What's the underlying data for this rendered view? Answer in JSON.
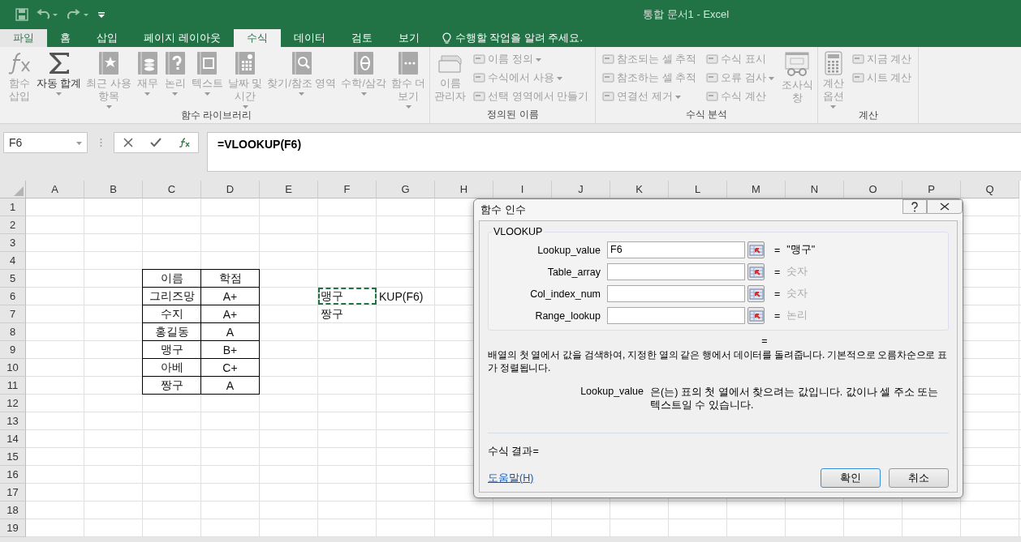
{
  "window": {
    "title": "통합 문서1 - Excel"
  },
  "tabs": [
    {
      "label": "파일",
      "kind": "file",
      "selected": false
    },
    {
      "label": "홈",
      "kind": "tab",
      "selected": false
    },
    {
      "label": "삽입",
      "kind": "tab",
      "selected": false
    },
    {
      "label": "페이지 레이아웃",
      "kind": "tab",
      "selected": false
    },
    {
      "label": "수식",
      "kind": "tab",
      "selected": true
    },
    {
      "label": "데이터",
      "kind": "tab",
      "selected": false
    },
    {
      "label": "검토",
      "kind": "tab",
      "selected": false
    },
    {
      "label": "보기",
      "kind": "tab",
      "selected": false
    }
  ],
  "tell_me": {
    "label": "수행할 작업을 알려 주세요."
  },
  "ribbon": {
    "groups": [
      {
        "label": "함수 라이브러리",
        "items": [
          {
            "kind": "large",
            "label": "함수\n삽입",
            "disabled": true,
            "has_menu": false
          },
          {
            "kind": "large",
            "label": "자동 합계",
            "disabled": false,
            "has_menu": true
          },
          {
            "kind": "large",
            "label": "최근 사용\n항목",
            "disabled": true,
            "has_menu": true
          },
          {
            "kind": "large",
            "label": "재무",
            "disabled": true,
            "has_menu": true
          },
          {
            "kind": "large",
            "label": "논리",
            "disabled": true,
            "has_menu": true
          },
          {
            "kind": "large",
            "label": "텍스트",
            "disabled": true,
            "has_menu": true
          },
          {
            "kind": "large",
            "label": "날짜 및\n시간",
            "disabled": true,
            "has_menu": true
          },
          {
            "kind": "large",
            "label": "찾기/참조 영역",
            "disabled": true,
            "has_menu": true
          },
          {
            "kind": "large",
            "label": "수학/삼각",
            "disabled": true,
            "has_menu": true
          },
          {
            "kind": "large",
            "label": "함수 더\n보기",
            "disabled": true,
            "has_menu": true
          }
        ]
      },
      {
        "label": "정의된 이름",
        "items": [
          {
            "kind": "large",
            "label": "이름\n관리자",
            "disabled": true,
            "has_menu": false
          },
          {
            "kind": "stack",
            "items": [
              {
                "label": "이름 정의",
                "disabled": true,
                "has_menu": true
              },
              {
                "label": "수식에서 사용",
                "disabled": true,
                "has_menu": true
              },
              {
                "label": "선택 영역에서 만들기",
                "disabled": true,
                "has_menu": false
              }
            ]
          }
        ]
      },
      {
        "label": "수식 분석",
        "items": [
          {
            "kind": "stack",
            "items": [
              {
                "label": "참조되는 셀 추적",
                "disabled": true,
                "has_menu": false
              },
              {
                "label": "참조하는 셀 추적",
                "disabled": true,
                "has_menu": false
              },
              {
                "label": "연결선 제거",
                "disabled": true,
                "has_menu": true
              }
            ]
          },
          {
            "kind": "stack",
            "items": [
              {
                "label": "수식 표시",
                "disabled": true,
                "has_menu": false
              },
              {
                "label": "오류 검사",
                "disabled": true,
                "has_menu": true
              },
              {
                "label": "수식 계산",
                "disabled": true,
                "has_menu": false
              }
            ]
          },
          {
            "kind": "large",
            "label": "조사식\n창",
            "disabled": true,
            "has_menu": false
          }
        ]
      },
      {
        "label": "계산",
        "items": [
          {
            "kind": "large",
            "label": "계산\n옵션",
            "disabled": true,
            "has_menu": true
          },
          {
            "kind": "stack",
            "items": [
              {
                "label": "지금 계산",
                "disabled": true,
                "has_menu": false
              },
              {
                "label": "시트 계산",
                "disabled": true,
                "has_menu": false
              }
            ]
          }
        ]
      }
    ]
  },
  "formula_bar": {
    "name_box": "F6",
    "formula": "=VLOOKUP(F6)"
  },
  "sheet": {
    "columns": [
      "A",
      "B",
      "C",
      "D",
      "E",
      "F",
      "G",
      "H",
      "I",
      "J",
      "K",
      "L",
      "M",
      "N",
      "O",
      "P",
      "Q"
    ],
    "rows": [
      {
        "number": "1",
        "cells": []
      },
      {
        "number": "2",
        "cells": []
      },
      {
        "number": "3",
        "cells": []
      },
      {
        "number": "4",
        "cells": []
      },
      {
        "number": "5",
        "cells": [
          {
            "text": ""
          },
          {
            "text": ""
          },
          {
            "text": "이름",
            "boxed": true
          },
          {
            "text": "학점",
            "boxed": true
          }
        ]
      },
      {
        "number": "6",
        "cells": [
          {
            "text": ""
          },
          {
            "text": ""
          },
          {
            "text": "그리즈망",
            "boxed": true
          },
          {
            "text": "A+",
            "boxed": true
          },
          {
            "text": ""
          },
          {
            "text": "맹구",
            "boxed": false,
            "marquee": true
          },
          {
            "text": "KUP(F6)",
            "boxed": false
          }
        ]
      },
      {
        "number": "7",
        "cells": [
          {
            "text": ""
          },
          {
            "text": ""
          },
          {
            "text": "수지",
            "boxed": true
          },
          {
            "text": "A+",
            "boxed": true
          },
          {
            "text": ""
          },
          {
            "text": "짱구",
            "boxed": false
          }
        ]
      },
      {
        "number": "8",
        "cells": [
          {
            "text": ""
          },
          {
            "text": ""
          },
          {
            "text": "홍길동",
            "boxed": true
          },
          {
            "text": "A",
            "boxed": true
          }
        ]
      },
      {
        "number": "9",
        "cells": [
          {
            "text": ""
          },
          {
            "text": ""
          },
          {
            "text": "맹구",
            "boxed": true
          },
          {
            "text": "B+",
            "boxed": true
          }
        ]
      },
      {
        "number": "10",
        "cells": [
          {
            "text": ""
          },
          {
            "text": ""
          },
          {
            "text": "아베",
            "boxed": true
          },
          {
            "text": "C+",
            "boxed": true
          }
        ]
      },
      {
        "number": "11",
        "cells": [
          {
            "text": ""
          },
          {
            "text": ""
          },
          {
            "text": "짱구",
            "boxed": true
          },
          {
            "text": "A",
            "boxed": true
          }
        ]
      },
      {
        "number": "12",
        "cells": []
      },
      {
        "number": "13",
        "cells": []
      },
      {
        "number": "14",
        "cells": []
      },
      {
        "number": "15",
        "cells": []
      },
      {
        "number": "16",
        "cells": []
      },
      {
        "number": "17",
        "cells": []
      },
      {
        "number": "18",
        "cells": []
      },
      {
        "number": "19",
        "cells": []
      }
    ]
  },
  "dialog": {
    "title": "함수 인수",
    "function_name": "VLOOKUP",
    "arguments": [
      {
        "name": "Lookup_value",
        "value": "F6",
        "equals": "=",
        "result": "\"맹구\"",
        "hint": false
      },
      {
        "name": "Table_array",
        "equals": "=",
        "result": "숫자",
        "hint": true
      },
      {
        "name": "Col_index_num",
        "equals": "=",
        "result": "숫자",
        "hint": true
      },
      {
        "name": "Range_lookup",
        "equals": "=",
        "result": "논리",
        "hint": true
      }
    ],
    "result_equals": "=",
    "description": "배열의 첫 열에서 값을 검색하여, 지정한 열의 같은 행에서 데이터를 돌려줍니다. 기본적으로 오름차순으로 표가 정렬됩니다.",
    "argument_help": {
      "name": "Lookup_value",
      "text": "은(는) 표의 첫 열에서 찾으려는 값입니다. 값이나 셀 주소 또는 텍스트일 수 있습니다."
    },
    "formula_result": "수식 결과=",
    "help_link": "도움말(H)",
    "buttons": [
      {
        "label": "확인",
        "kind": "default"
      },
      {
        "label": "취소",
        "kind": "normal"
      }
    ]
  }
}
